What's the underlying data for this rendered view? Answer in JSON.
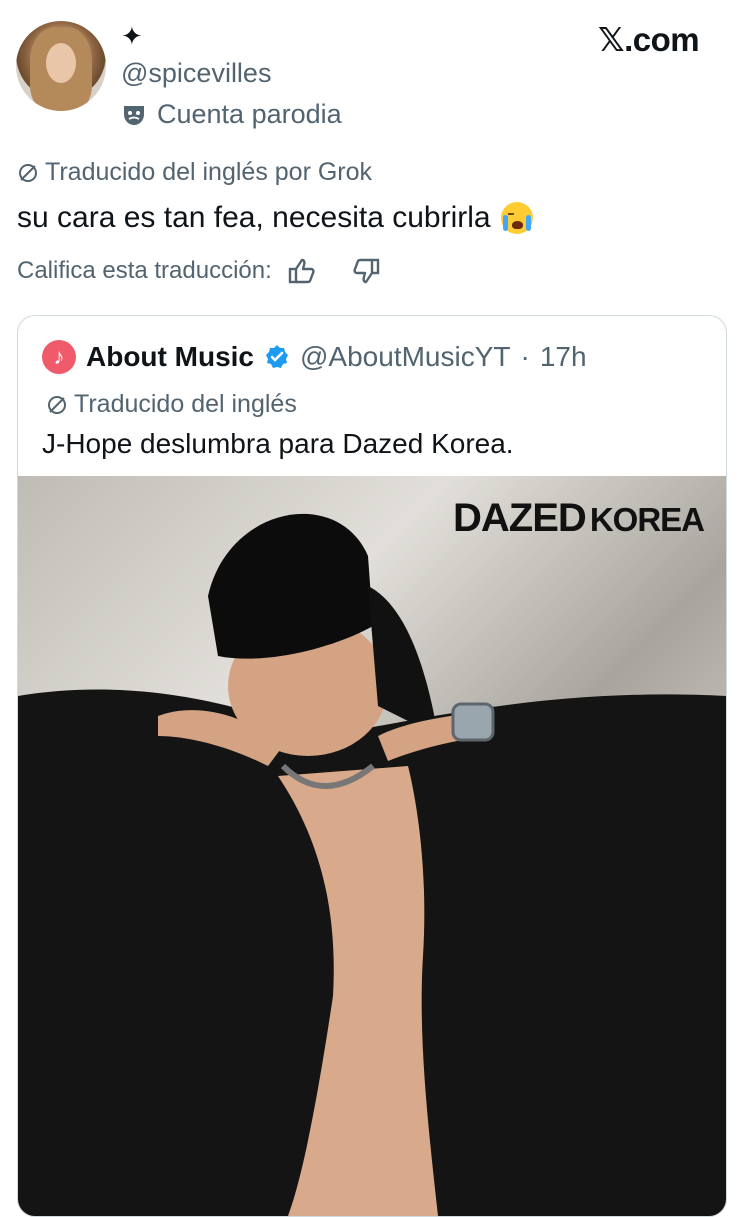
{
  "header": {
    "sparkle_icon": "✦",
    "handle": "@spicevilles",
    "parody_label": "Cuenta parodia",
    "site_logo": "𝕏.com"
  },
  "tweet": {
    "translated_label": "Traducido del inglés por Grok",
    "text": "su cara es tan fea, necesita cubrirla",
    "emoji": "loudly-crying-face",
    "rate_label": "Califica esta traducción:"
  },
  "quoted": {
    "name": "About Music",
    "handle": "@AboutMusicYT",
    "separator": "·",
    "time": "17h",
    "translated_label": "Traducido del inglés",
    "text": "J-Hope deslumbra para Dazed Korea.",
    "photo_logo_main": "DAZED",
    "photo_logo_sub": "KOREA"
  },
  "colors": {
    "text": "#0f1419",
    "secondary": "#536471",
    "verified": "#1d9bf0",
    "border": "#cfd9de",
    "music_icon": "#f05b6b"
  }
}
